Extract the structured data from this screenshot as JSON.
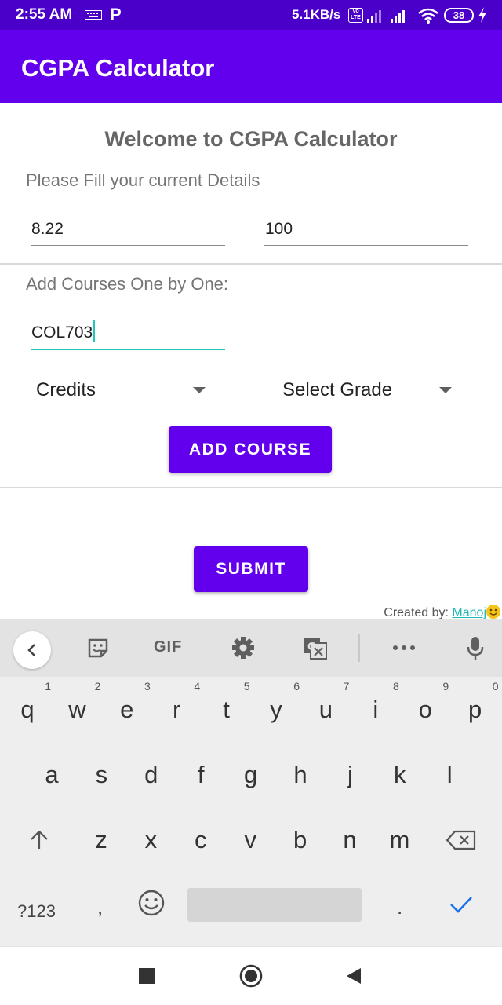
{
  "status_bar": {
    "time": "2:55 AM",
    "p_icon": "P",
    "speed": "5.1KB/s",
    "volte": "Vo LTE",
    "battery": "38",
    "icons": [
      "keyboard-icon",
      "parking-icon",
      "volte-icon",
      "signal-icon",
      "wifi-icon",
      "battery-icon",
      "charging-icon"
    ]
  },
  "app_bar": {
    "title": "CGPA Calculator"
  },
  "main": {
    "welcome": "Welcome to CGPA Calculator",
    "subtitle": "Please Fill your current Details",
    "current_cgpa": "8.22",
    "current_credits": "100",
    "add_courses_label": "Add Courses One by One:",
    "course_code": "COL703",
    "credits_spinner": "Credits",
    "grade_spinner": "Select Grade",
    "add_course_button": "ADD COURSE",
    "submit_button": "SUBMIT",
    "credit_prefix": "Created by: ",
    "credit_name": "Manoj"
  },
  "keyboard": {
    "toolbar": {
      "gif": "GIF",
      "icons": [
        "back-icon",
        "sticker-icon",
        "gif-icon",
        "settings-icon",
        "translate-icon",
        "more-icon",
        "mic-icon"
      ]
    },
    "row1": [
      "q",
      "w",
      "e",
      "r",
      "t",
      "y",
      "u",
      "i",
      "o",
      "p"
    ],
    "row1_hints": [
      "1",
      "2",
      "3",
      "4",
      "5",
      "6",
      "7",
      "8",
      "9",
      "0"
    ],
    "row2": [
      "a",
      "s",
      "d",
      "f",
      "g",
      "h",
      "j",
      "k",
      "l"
    ],
    "row3": [
      "z",
      "x",
      "c",
      "v",
      "b",
      "n",
      "m"
    ],
    "row4": {
      "symbols": "?123",
      "comma": ",",
      "period": "."
    },
    "accent_color": "#1a73e8"
  },
  "colors": {
    "status_bar": "#4a00c8",
    "primary": "#6200ee",
    "focus_underline": "#1fc7be"
  }
}
